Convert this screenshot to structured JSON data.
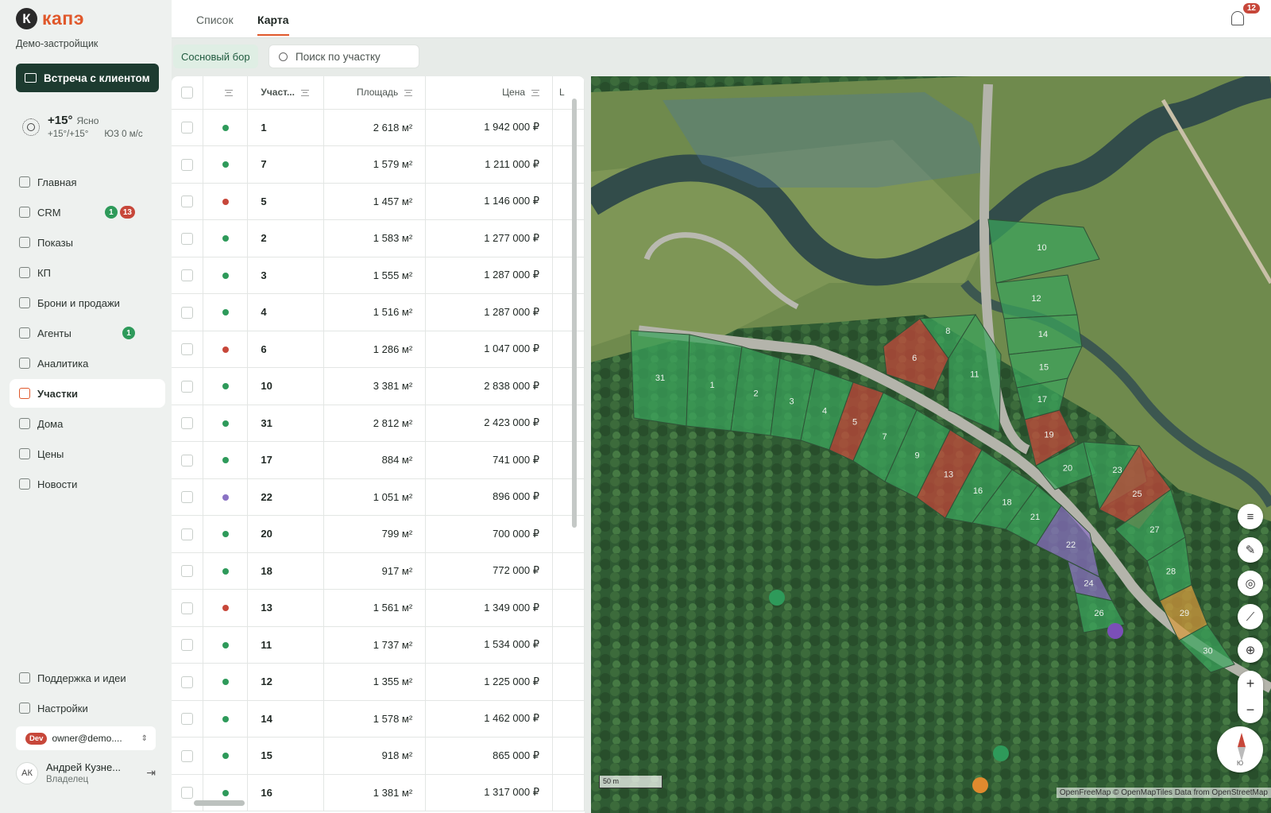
{
  "app": {
    "logo_letter": "К",
    "logo_text": "капэ",
    "company": "Демо-застройщик",
    "meet_button": "Встреча с клиентом"
  },
  "weather": {
    "temp": "+15°",
    "condition": "Ясно",
    "range": "+15°/+15°",
    "wind": "ЮЗ 0 м/с"
  },
  "nav": [
    {
      "label": "Главная",
      "name": "home"
    },
    {
      "label": "CRM",
      "name": "crm",
      "badges": [
        {
          "text": "1",
          "color": "green"
        },
        {
          "text": "13",
          "color": "red"
        }
      ]
    },
    {
      "label": "Показы",
      "name": "showings"
    },
    {
      "label": "КП",
      "name": "kp"
    },
    {
      "label": "Брони и продажи",
      "name": "bookings"
    },
    {
      "label": "Агенты",
      "name": "agents",
      "badges": [
        {
          "text": "1",
          "color": "green"
        }
      ]
    },
    {
      "label": "Аналитика",
      "name": "analytics"
    },
    {
      "label": "Участки",
      "name": "plots",
      "active": true
    },
    {
      "label": "Дома",
      "name": "houses"
    },
    {
      "label": "Цены",
      "name": "prices"
    },
    {
      "label": "Новости",
      "name": "news"
    }
  ],
  "bottom_nav": [
    {
      "label": "Поддержка и идеи",
      "name": "support"
    },
    {
      "label": "Настройки",
      "name": "settings"
    }
  ],
  "account": {
    "env_tag": "Dev",
    "email": "owner@demo....",
    "initials": "АК",
    "name": "Андрей Кузне...",
    "role": "Владелец"
  },
  "tabs": [
    {
      "label": "Список",
      "active": false
    },
    {
      "label": "Карта",
      "active": true
    }
  ],
  "notifications": {
    "count": "12"
  },
  "filters": {
    "project_chip": "Сосновый бор",
    "search_placeholder": "Поиск по участку"
  },
  "table": {
    "columns": {
      "plot": "Участ...",
      "area": "Площадь",
      "price": "Цена",
      "extra": "L"
    },
    "status_colors": {
      "free": "#2e9a5a",
      "sold": "#c7473a",
      "reserved": "#8a72c4"
    },
    "rows": [
      {
        "num": "1",
        "status": "free",
        "area": "2 618 м²",
        "price": "1 942 000 ₽"
      },
      {
        "num": "7",
        "status": "free",
        "area": "1 579 м²",
        "price": "1 211 000 ₽"
      },
      {
        "num": "5",
        "status": "sold",
        "area": "1 457 м²",
        "price": "1 146 000 ₽"
      },
      {
        "num": "2",
        "status": "free",
        "area": "1 583 м²",
        "price": "1 277 000 ₽"
      },
      {
        "num": "3",
        "status": "free",
        "area": "1 555 м²",
        "price": "1 287 000 ₽"
      },
      {
        "num": "4",
        "status": "free",
        "area": "1 516 м²",
        "price": "1 287 000 ₽"
      },
      {
        "num": "6",
        "status": "sold",
        "area": "1 286 м²",
        "price": "1 047 000 ₽"
      },
      {
        "num": "10",
        "status": "free",
        "area": "3 381 м²",
        "price": "2 838 000 ₽"
      },
      {
        "num": "31",
        "status": "free",
        "area": "2 812 м²",
        "price": "2 423 000 ₽"
      },
      {
        "num": "17",
        "status": "free",
        "area": "884 м²",
        "price": "741 000 ₽"
      },
      {
        "num": "22",
        "status": "reserved",
        "area": "1 051 м²",
        "price": "896 000 ₽"
      },
      {
        "num": "20",
        "status": "free",
        "area": "799 м²",
        "price": "700 000 ₽"
      },
      {
        "num": "18",
        "status": "free",
        "area": "917 м²",
        "price": "772 000 ₽"
      },
      {
        "num": "13",
        "status": "sold",
        "area": "1 561 м²",
        "price": "1 349 000 ₽"
      },
      {
        "num": "11",
        "status": "free",
        "area": "1 737 м²",
        "price": "1 534 000 ₽"
      },
      {
        "num": "12",
        "status": "free",
        "area": "1 355 м²",
        "price": "1 225 000 ₽"
      },
      {
        "num": "14",
        "status": "free",
        "area": "1 578 м²",
        "price": "1 462 000 ₽"
      },
      {
        "num": "15",
        "status": "free",
        "area": "918 м²",
        "price": "865 000 ₽"
      },
      {
        "num": "16",
        "status": "free",
        "area": "1 381 м²",
        "price": "1 317 000 ₽"
      }
    ]
  },
  "map": {
    "scale_label": "50 m",
    "attribution": "OpenFreeMap © OpenMapTiles Data from OpenStreetMap",
    "compass_label": "Ю",
    "zoom_in": "+",
    "zoom_out": "−",
    "plot_colors": {
      "free": "#3aa35c",
      "sold": "#c7473a",
      "reserved": "#8a6fc4",
      "other": "#d79a3c"
    },
    "plots": [
      {
        "label": "31",
        "status": "free"
      },
      {
        "label": "1",
        "status": "free"
      },
      {
        "label": "2",
        "status": "free"
      },
      {
        "label": "3",
        "status": "free"
      },
      {
        "label": "4",
        "status": "free"
      },
      {
        "label": "5",
        "status": "sold"
      },
      {
        "label": "7",
        "status": "free"
      },
      {
        "label": "9",
        "status": "free"
      },
      {
        "label": "13",
        "status": "sold"
      },
      {
        "label": "16",
        "status": "free"
      },
      {
        "label": "18",
        "status": "free"
      },
      {
        "label": "21",
        "status": "free"
      },
      {
        "label": "22",
        "status": "reserved"
      },
      {
        "label": "24",
        "status": "reserved"
      },
      {
        "label": "26",
        "status": "free"
      },
      {
        "label": "6",
        "status": "sold"
      },
      {
        "label": "8",
        "status": "free"
      },
      {
        "label": "11",
        "status": "free"
      },
      {
        "label": "10",
        "status": "free"
      },
      {
        "label": "12",
        "status": "free"
      },
      {
        "label": "14",
        "status": "free"
      },
      {
        "label": "15",
        "status": "free"
      },
      {
        "label": "17",
        "status": "free"
      },
      {
        "label": "19",
        "status": "sold"
      },
      {
        "label": "20",
        "status": "free"
      },
      {
        "label": "23",
        "status": "free"
      },
      {
        "label": "25",
        "status": "sold"
      },
      {
        "label": "27",
        "status": "free"
      },
      {
        "label": "28",
        "status": "free"
      },
      {
        "label": "29",
        "status": "other"
      },
      {
        "label": "30",
        "status": "free"
      }
    ]
  }
}
